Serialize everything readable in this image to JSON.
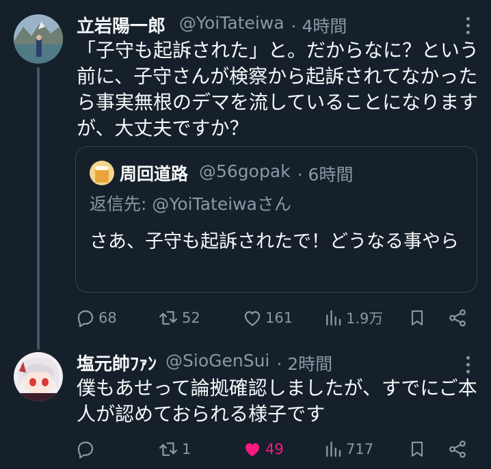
{
  "tweet1": {
    "name": "立岩陽一郎",
    "handle": "@YoiTateiwa",
    "time": "· 4時間",
    "text": "「子守も起訴された」と。だからなに？という前に、子守さんが検察から起訴されてなかったら事実無根のデマを流していることになりますが、大丈夫ですか？",
    "quote": {
      "name": "周回道路",
      "handle": "@56gopak",
      "time": "· 6時間",
      "reply_to": "返信先: @YoiTateiwaさん",
      "text": "さあ、子守も起訴されたで！どうなる事やら"
    },
    "actions": {
      "replies": "68",
      "retweets": "52",
      "likes": "161",
      "views": "1.9万"
    }
  },
  "tweet2": {
    "name": "塩元帥ﾌｧﾝ",
    "handle": "@SioGenSui",
    "time": "· 2時間",
    "text": "僕もあせって論拠確認しましたが、すでにご本人が認めておられる様子です",
    "actions": {
      "replies": "",
      "retweets": "1",
      "likes": "49",
      "views": "717"
    }
  },
  "colors": {
    "background": "#15202b",
    "text": "#f7f9f9",
    "secondary": "#8b98a5",
    "like": "#f91880",
    "border": "#38444d"
  },
  "icons": [
    "reply-icon",
    "retweet-icon",
    "like-icon",
    "views-icon",
    "bookmark-icon",
    "share-icon",
    "more-icon"
  ]
}
